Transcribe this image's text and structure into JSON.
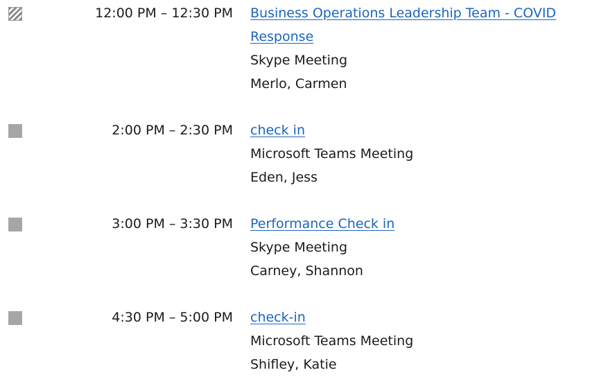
{
  "colors": {
    "link": "#1a65bf",
    "text": "#1b1b1b",
    "busy_status": "#a6a6a6",
    "tentative_status": "#8a8a8a"
  },
  "events": [
    {
      "time": "12:00 PM – 12:30 PM",
      "subject_line1": "Business Operations Leadership Team - COVID",
      "subject_line2": "Response",
      "location": "Skype Meeting",
      "organizer": "Merlo, Carmen",
      "status": "tentative"
    },
    {
      "time": "2:00 PM – 2:30 PM",
      "subject": "check in",
      "location": "Microsoft Teams Meeting",
      "organizer": "Eden, Jess",
      "status": "busy"
    },
    {
      "time": "3:00 PM – 3:30 PM",
      "subject": "Performance Check in",
      "location": "Skype Meeting",
      "organizer": "Carney, Shannon",
      "status": "busy"
    },
    {
      "time": "4:30 PM – 5:00 PM",
      "subject": "check-in",
      "location": "Microsoft Teams Meeting",
      "organizer": "Shifley, Katie",
      "status": "busy"
    }
  ]
}
